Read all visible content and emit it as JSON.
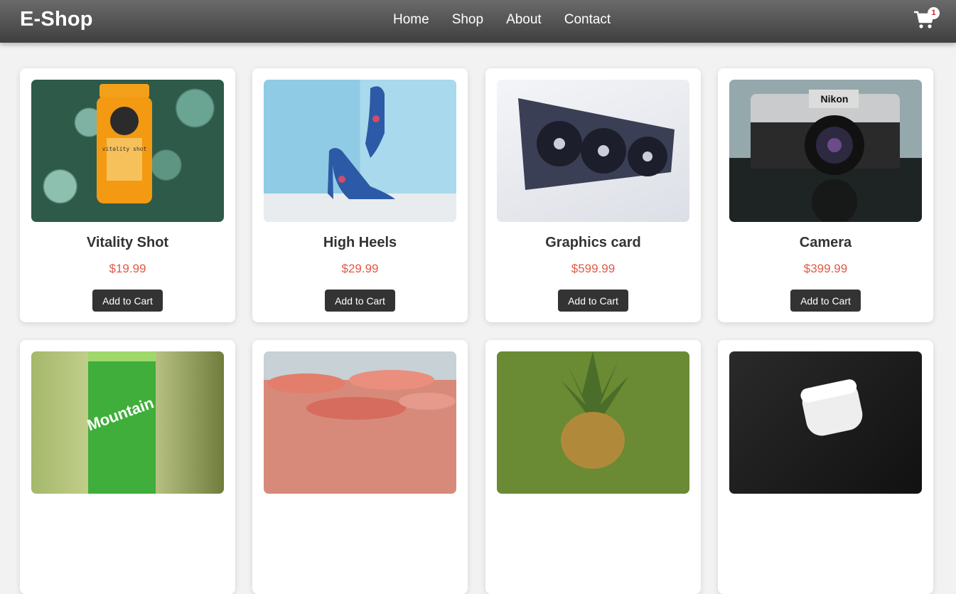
{
  "header": {
    "brand": "E-Shop",
    "nav": [
      "Home",
      "Shop",
      "About",
      "Contact"
    ],
    "cart_count": "1"
  },
  "products": [
    {
      "name": "Vitality Shot",
      "price": "$19.99",
      "button": "Add to Cart"
    },
    {
      "name": "High Heels",
      "price": "$29.99",
      "button": "Add to Cart"
    },
    {
      "name": "Graphics card",
      "price": "$599.99",
      "button": "Add to Cart"
    },
    {
      "name": "Camera",
      "price": "$399.99",
      "button": "Add to Cart"
    },
    {
      "name": "",
      "price": "",
      "button": ""
    },
    {
      "name": "",
      "price": "",
      "button": ""
    },
    {
      "name": "",
      "price": "",
      "button": ""
    },
    {
      "name": "",
      "price": "",
      "button": ""
    }
  ],
  "bottle_label": "vitality shot",
  "camera_brand": "Nikon",
  "can_text": "Mountain",
  "colors": {
    "nav_bg": "#4f4f4f",
    "price": "#e05a47",
    "button_bg": "#333333",
    "page_bg": "#f2f2f2"
  }
}
